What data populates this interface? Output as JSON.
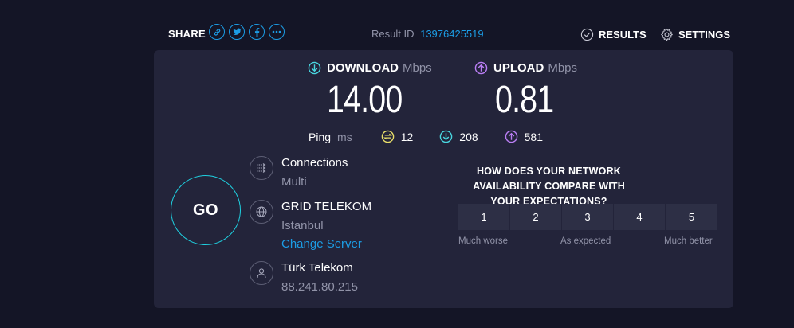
{
  "header": {
    "share_label": "SHARE",
    "share_icons": [
      "link-icon",
      "twitter-icon",
      "facebook-icon",
      "more-icon"
    ],
    "result_label": "Result ID",
    "result_id": "13976425519",
    "results_label": "RESULTS",
    "settings_label": "SETTINGS"
  },
  "download": {
    "label": "DOWNLOAD",
    "unit": "Mbps",
    "value": "14.00"
  },
  "upload": {
    "label": "UPLOAD",
    "unit": "Mbps",
    "value": "0.81"
  },
  "ping": {
    "label": "Ping",
    "unit": "ms",
    "idle": "12",
    "download": "208",
    "upload": "581"
  },
  "go_label": "GO",
  "connections": {
    "title": "Connections",
    "value": "Multi"
  },
  "server": {
    "name": "GRID TELEKOM",
    "location": "Istanbul",
    "change_label": "Change Server"
  },
  "isp": {
    "name": "Türk Telekom",
    "ip": "88.241.80.215"
  },
  "survey": {
    "question": "HOW DOES YOUR NETWORK AVAILABILITY COMPARE WITH YOUR EXPECTATIONS?",
    "options": [
      "1",
      "2",
      "3",
      "4",
      "5"
    ],
    "low_label": "Much worse",
    "mid_label": "As expected",
    "high_label": "Much better"
  },
  "colors": {
    "background": "#141526",
    "panel": "#23243a",
    "accent_blue": "#1c9ce4",
    "download": "#49d6e0",
    "upload": "#b97ef3",
    "ping": "#e9df6a"
  }
}
